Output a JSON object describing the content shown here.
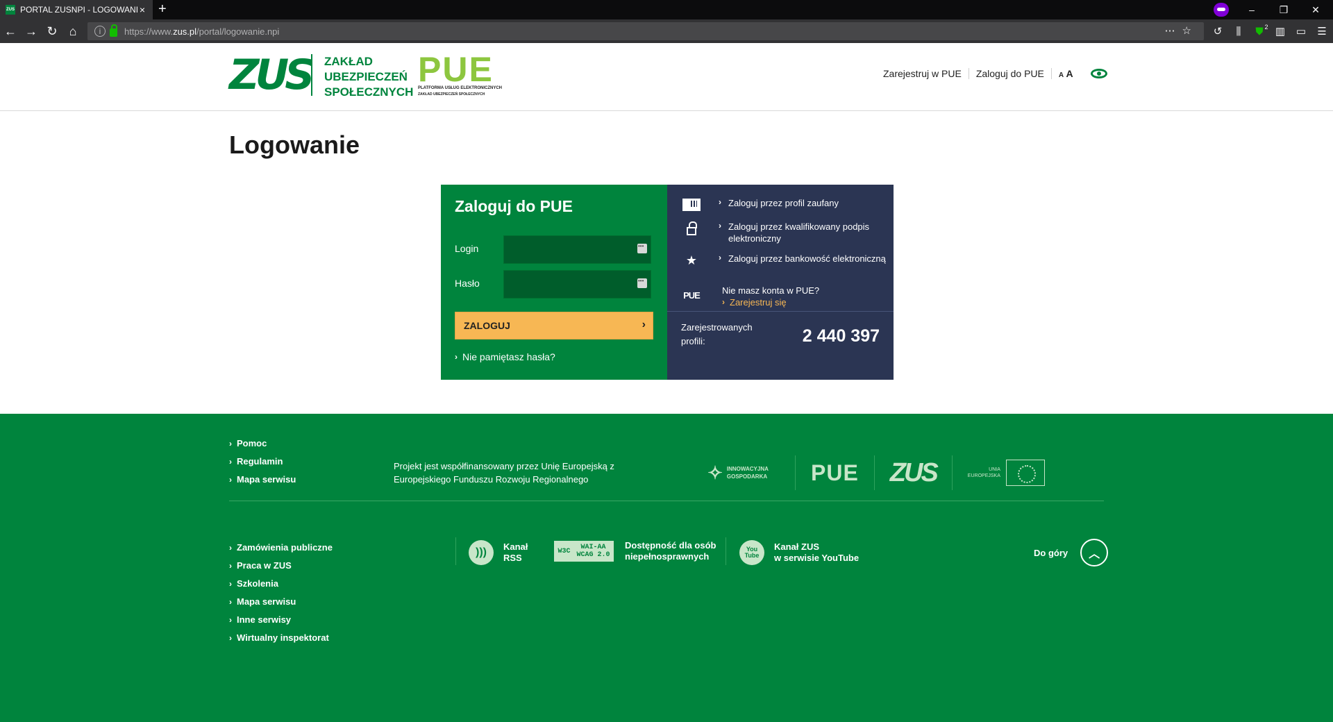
{
  "browser": {
    "tab_title": "PORTAL ZUSNPI - LOGOWANIE",
    "tab_favicon": "zus-favicon",
    "url_host_prefix": "https://www.",
    "url_host": "zus.pl",
    "url_path": "/portal/logowanie.npi",
    "window_controls": [
      "–",
      "❐",
      "✕"
    ],
    "extension_badge": "2"
  },
  "header": {
    "zus_logo": "ZUS",
    "org_name_lines": [
      "ZAKŁAD",
      "UBEZPIECZEŃ",
      "SPOŁECZNYCH"
    ],
    "pue_logo": "PUE",
    "pue_sub1": "PLATFORMA USŁUG ELEKTRONICZNYCH",
    "pue_sub2": "ZAKŁAD UBEZPIECZEŃ SPOŁECZNYCH",
    "links": {
      "register": "Zarejestruj w PUE",
      "login": "Zaloguj do PUE",
      "font_small": "A",
      "font_large": "A"
    }
  },
  "main": {
    "page_title": "Logowanie",
    "login_box": {
      "heading": "Zaloguj do PUE",
      "login_label": "Login",
      "password_label": "Hasło",
      "login_value": "",
      "password_value": "",
      "submit_label": "ZALOGUJ",
      "forgot_label": "Nie pamiętasz hasła?"
    },
    "alt_box": {
      "options": [
        {
          "icon": "trusted-profile-icon",
          "text": "Zaloguj przez profil zaufany"
        },
        {
          "icon": "lock-icon",
          "text": "Zaloguj przez kwalifikowany podpis elektroniczny"
        },
        {
          "icon": "star-icon",
          "text": "Zaloguj przez bankowość elektroniczną"
        }
      ],
      "no_account_text": "Nie masz konta w PUE?",
      "register_link": "Zarejestruj się",
      "pue_mini": "PUE",
      "stat_label": "Zarejestrowanych profili:",
      "stat_value": "2 440 397"
    }
  },
  "footer": {
    "top_links": [
      "Pomoc",
      "Regulamin",
      "Mapa serwisu"
    ],
    "eu_text": "Projekt jest współfinansowany przez Unię Europejską z Europejskiego Funduszu Rozwoju Regionalnego",
    "partners": {
      "ig_line1": "INNOWACYJNA",
      "ig_line2": "GOSPODARKA",
      "pue": "PUE",
      "zus": "ZUS",
      "eu_line1": "UNIA",
      "eu_line2": "EUROPEJSKA"
    },
    "bottom_links": [
      "Zamówienia publiczne",
      "Praca w ZUS",
      "Szkolenia",
      "Mapa serwisu",
      "Inne serwisy",
      "Wirtualny inspektorat"
    ],
    "rss": {
      "line1": "Kanał",
      "line2": "RSS"
    },
    "w3c": {
      "w3c": "W3C",
      "badge1": "WAI-AA",
      "badge2": "WCAG 2.0",
      "line1": "Dostępność dla osób",
      "line2": "niepełnosprawnych"
    },
    "youtube": {
      "icon_text": "You Tube",
      "line1": "Kanał ZUS",
      "line2": "w serwisie YouTube"
    },
    "to_top": "Do góry"
  },
  "colors": {
    "brand_green": "#00843d",
    "navy": "#2b3553",
    "accent_orange": "#f7b754"
  }
}
